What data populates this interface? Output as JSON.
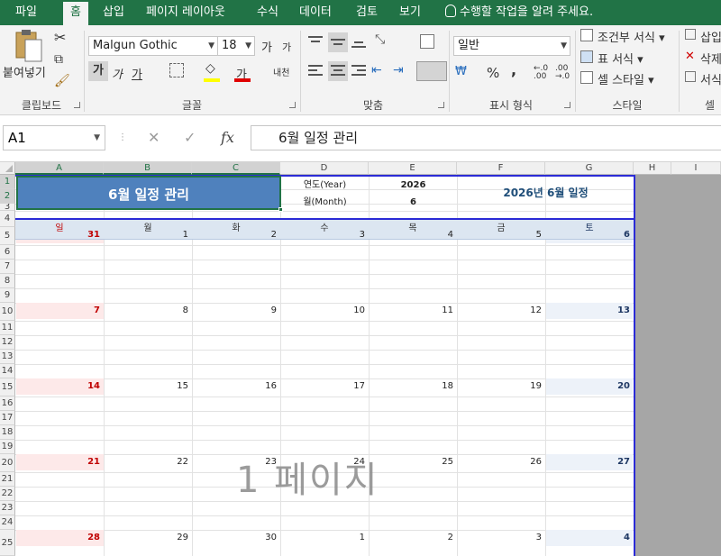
{
  "ribbon_tabs": [
    "파일",
    "홈",
    "삽입",
    "페이지 레이아웃",
    "수식",
    "데이터",
    "검토",
    "보기"
  ],
  "active_tab": "홈",
  "tell_me": "수행할 작업을 알려 주세요.",
  "clipboard": {
    "paste_label": "붙여넣기",
    "group_label": "클립보드"
  },
  "font": {
    "name": "Malgun Gothic",
    "size": "18",
    "group_label": "글꼴",
    "bold": "가",
    "italic": "가",
    "underline": "가",
    "grow": "가",
    "shrink": "가",
    "fill": "",
    "font_color": "가",
    "phonetic": "내천"
  },
  "alignment": {
    "group_label": "맞춤"
  },
  "number": {
    "format": "일반",
    "group_label": "표시 형식",
    "percent": "%",
    "comma": ","
  },
  "styles": {
    "conditional": "조건부 서식",
    "table": "표 서식",
    "cell": "셀 스타일",
    "group_label": "스타일"
  },
  "cells": {
    "insert": "삽입",
    "delete": "삭제",
    "format": "서식",
    "group_label": "셀"
  },
  "formula_bar": {
    "name_box": "A1",
    "content": "6월 일정 관리",
    "fx": "fx"
  },
  "columns": [
    "A",
    "B",
    "C",
    "D",
    "E",
    "F",
    "G",
    "H",
    "I"
  ],
  "rows": [
    "1",
    "2",
    "3",
    "4",
    "5",
    "6",
    "7",
    "8",
    "9",
    "10",
    "11",
    "12",
    "13",
    "14",
    "15",
    "16",
    "17",
    "18",
    "19",
    "20",
    "21",
    "22",
    "23",
    "24",
    "25"
  ],
  "sheet": {
    "title": "6월 일정 관리",
    "year_label": "연도(Year)",
    "year_value": "2026",
    "month_label": "월(Month)",
    "month_value": "6",
    "subtitle": "2026년 6월 일정",
    "weekdays": [
      "일",
      "월",
      "화",
      "수",
      "목",
      "금",
      "토"
    ],
    "weeks": [
      [
        "31",
        "1",
        "2",
        "3",
        "4",
        "5",
        "6"
      ],
      [
        "7",
        "8",
        "9",
        "10",
        "11",
        "12",
        "13"
      ],
      [
        "14",
        "15",
        "16",
        "17",
        "18",
        "19",
        "20"
      ],
      [
        "21",
        "22",
        "23",
        "24",
        "25",
        "26",
        "27"
      ],
      [
        "28",
        "29",
        "30",
        "1",
        "2",
        "3",
        "4"
      ]
    ],
    "page_watermark": "1 페이지"
  },
  "colors": {
    "excel_green": "#217346",
    "title_fill": "#4f81bd",
    "sunday": "#c00000",
    "saturday": "#1f3864",
    "page_break": "#2b2bd6"
  }
}
